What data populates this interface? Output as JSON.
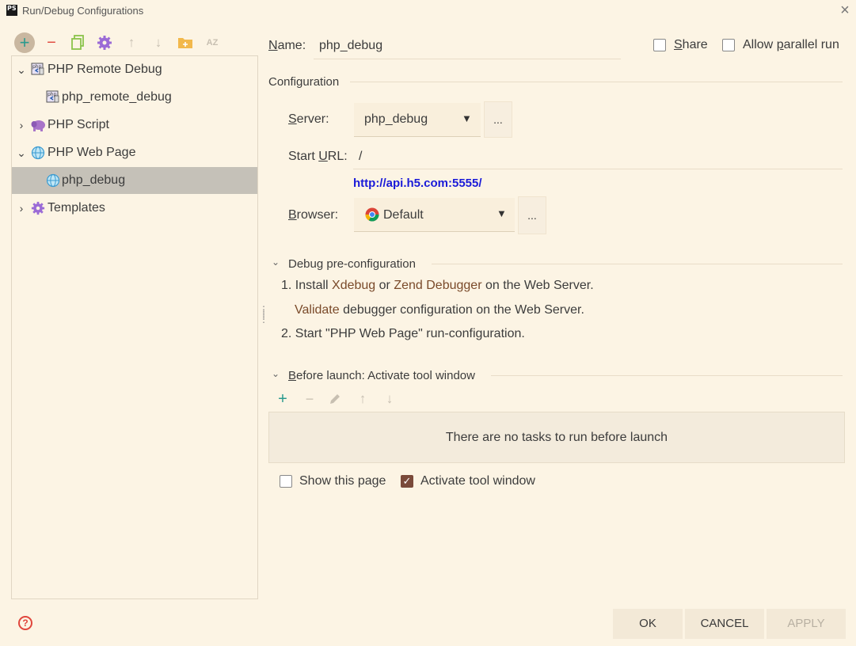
{
  "window": {
    "title": "Run/Debug Configurations",
    "app_icon_text": "PS"
  },
  "toolbar": {
    "add": "+",
    "remove": "−",
    "copy": "copy",
    "settings": "gear",
    "move_up": "↑",
    "move_down": "↓",
    "folder": "folder",
    "sort": "AZ"
  },
  "tree": {
    "items": [
      {
        "label": "PHP Remote Debug",
        "icon": "php-remote-debug-icon",
        "expanded": true,
        "level": 0
      },
      {
        "label": "php_remote_debug",
        "icon": "php-remote-debug-icon",
        "level": 1
      },
      {
        "label": "PHP Script",
        "icon": "php-elephant-icon",
        "expanded": false,
        "level": 0
      },
      {
        "label": "PHP Web Page",
        "icon": "globe-icon",
        "expanded": true,
        "level": 0
      },
      {
        "label": "php_debug",
        "icon": "globe-icon",
        "level": 1,
        "selected": true
      },
      {
        "label": "Templates",
        "icon": "gear-icon",
        "expanded": false,
        "level": 0
      }
    ]
  },
  "form": {
    "name_label_u": "N",
    "name_label_rest": "ame:",
    "name_value": "php_debug",
    "share_label_u": "S",
    "share_label_rest": "hare",
    "share_checked": false,
    "parallel_label_pre": "Allow ",
    "parallel_label_u": "p",
    "parallel_label_rest": "arallel run",
    "parallel_checked": false,
    "configuration_title": "Configuration",
    "server_label_u": "S",
    "server_label_rest": "erver:",
    "server_value": "php_debug",
    "server_more": "...",
    "start_url_label_pre": "Start ",
    "start_url_label_u": "U",
    "start_url_label_rest": "RL:",
    "start_url_value": "/",
    "url_link": "http://api.h5.com:5555/",
    "browser_label_u": "B",
    "browser_label_rest": "rowser:",
    "browser_value": "Default",
    "browser_more": "..."
  },
  "debug_pre": {
    "title": "Debug pre-configuration",
    "step1_pre": "1. Install ",
    "xdebug": "Xdebug",
    "or": " or ",
    "zend": "Zend Debugger",
    "step1_post": " on the Web Server.",
    "validate": "Validate",
    "validate_rest": " debugger configuration on the Web Server.",
    "step2": "2. Start \"PHP Web Page\" run-configuration."
  },
  "before_launch": {
    "title_u": "B",
    "title_rest": "efore launch: Activate tool window",
    "empty_text": "There are no tasks to run before launch",
    "add": "+",
    "remove": "−",
    "edit": "edit",
    "up": "↑",
    "down": "↓"
  },
  "options": {
    "show_page_label": "Show this page",
    "show_page_checked": false,
    "activate_label": "Activate tool window",
    "activate_checked": true
  },
  "buttons": {
    "ok": "OK",
    "cancel": "CANCEL",
    "apply": "APPLY",
    "help": "?"
  },
  "colors": {
    "background": "#fcf4e4",
    "link": "#1a1ad8",
    "accent_teal": "#2a9a8e",
    "accent_red": "#e0463c",
    "brown": "#7a4a2a",
    "selection": "#c5c1b8"
  }
}
